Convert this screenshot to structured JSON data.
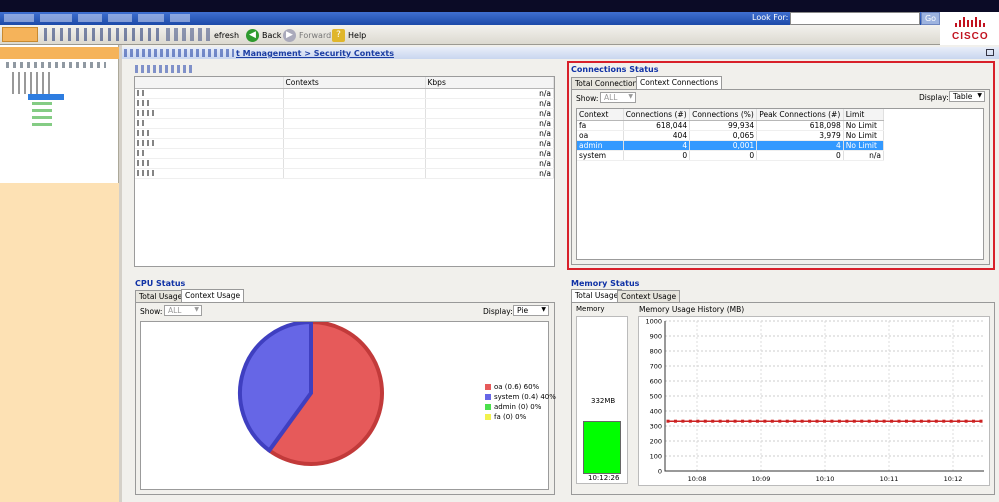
{
  "toolbar": {
    "refresh": "efresh",
    "back": "Back",
    "forward": "Forward",
    "help": "Help"
  },
  "search": {
    "label": "Look For:",
    "go": "Go"
  },
  "brand": {
    "name": "CISCO"
  },
  "breadcrumb": "t Management > Security Contexts",
  "contexts_table": {
    "columns": [
      "Contexts",
      "Kbps"
    ],
    "rows": [
      "n/a",
      "n/a",
      "n/a",
      "n/a",
      "n/a",
      "n/a",
      "n/a",
      "n/a",
      "n/a"
    ]
  },
  "connections": {
    "title": "Connections Status",
    "tabs": [
      "Total Connections",
      "Context Connections"
    ],
    "show_label": "Show:",
    "show_value": "ALL",
    "display_label": "Display:",
    "display_value": "Table",
    "columns": [
      "Context",
      "Connections (#)",
      "Connections (%)",
      "Peak Connections (#)",
      "Limit"
    ],
    "rows": [
      [
        "fa",
        "618,044",
        "99,934",
        "618,098",
        "No Limit"
      ],
      [
        "oa",
        "404",
        "0,065",
        "3,979",
        "No Limit"
      ],
      [
        "admin",
        "4",
        "0,001",
        "4",
        "No Limit"
      ],
      [
        "system",
        "0",
        "0",
        "0",
        "n/a"
      ]
    ]
  },
  "cpu": {
    "title": "CPU Status",
    "tabs": [
      "Total Usage",
      "Context Usage"
    ],
    "show_label": "Show:",
    "show_value": "ALL",
    "display_label": "Display:",
    "display_value": "Pie",
    "legend": [
      "oa (0.6) 60%",
      "system (0.4) 40%",
      "admin (0) 0%",
      "fa (0) 0%"
    ],
    "colors": [
      "#e65a5a",
      "#6666e6",
      "#4be04b",
      "#f2f24d"
    ]
  },
  "memory": {
    "title": "Memory Status",
    "tabs": [
      "Total Usage",
      "Context Usage"
    ],
    "memory_label": "Memory",
    "memory_value": "332MB",
    "memory_fraction": 0.332,
    "memory_time": "10:12:26",
    "history_title": "Memory Usage History (MB)"
  },
  "chart_data": {
    "type": "line",
    "title": "Memory Usage History (MB)",
    "ylim": [
      0,
      1000
    ],
    "yticks": [
      "0",
      "100",
      "200",
      "300",
      "400",
      "500",
      "600",
      "700",
      "800",
      "900",
      "1000"
    ],
    "xticks": [
      "10:08",
      "10:09",
      "10:10",
      "10:11",
      "10:12"
    ],
    "series": [
      {
        "values": [
          332,
          332,
          332,
          332,
          332,
          332,
          332,
          332,
          332,
          332,
          332,
          332,
          332,
          332,
          332,
          332,
          332,
          332,
          332,
          332,
          332,
          332,
          332,
          332,
          332,
          332,
          332,
          332,
          332,
          332,
          332,
          332,
          332,
          332,
          332,
          332,
          332,
          332,
          332,
          332,
          332,
          332,
          332
        ]
      }
    ],
    "grid": true
  },
  "pie_data": {
    "type": "pie",
    "values": [
      0.6,
      0.4,
      0,
      0
    ]
  }
}
